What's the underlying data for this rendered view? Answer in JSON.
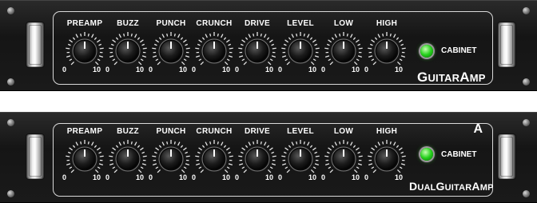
{
  "units": [
    {
      "id": "top",
      "knobs": [
        {
          "label": "PREAMP",
          "min": "0",
          "max": "10"
        },
        {
          "label": "BUZZ",
          "min": "0",
          "max": "10"
        },
        {
          "label": "PUNCH",
          "min": "0",
          "max": "10"
        },
        {
          "label": "CRUNCH",
          "min": "0",
          "max": "10"
        },
        {
          "label": "DRIVE",
          "min": "0",
          "max": "10"
        },
        {
          "label": "LEVEL",
          "min": "0",
          "max": "10"
        },
        {
          "label": "LOW",
          "min": "0",
          "max": "10"
        },
        {
          "label": "HIGH",
          "min": "0",
          "max": "10"
        }
      ],
      "cabinet_label": "CABINET",
      "cabinet_led_on": true,
      "brand": "GUITARAMP",
      "slot_letter": ""
    },
    {
      "id": "bottom",
      "knobs": [
        {
          "label": "PREAMP",
          "min": "0",
          "max": "10"
        },
        {
          "label": "BUZZ",
          "min": "0",
          "max": "10"
        },
        {
          "label": "PUNCH",
          "min": "0",
          "max": "10"
        },
        {
          "label": "CRUNCH",
          "min": "0",
          "max": "10"
        },
        {
          "label": "DRIVE",
          "min": "0",
          "max": "10"
        },
        {
          "label": "LEVEL",
          "min": "0",
          "max": "10"
        },
        {
          "label": "LOW",
          "min": "0",
          "max": "10"
        },
        {
          "label": "HIGH",
          "min": "0",
          "max": "10"
        }
      ],
      "cabinet_label": "CABINET",
      "cabinet_led_on": true,
      "brand": "DUALGUITARAMP",
      "slot_letter": "A"
    }
  ],
  "colors": {
    "led": "#25d11b",
    "panel_text": "#ffffff",
    "rack_bg": "#1a1a1a"
  }
}
